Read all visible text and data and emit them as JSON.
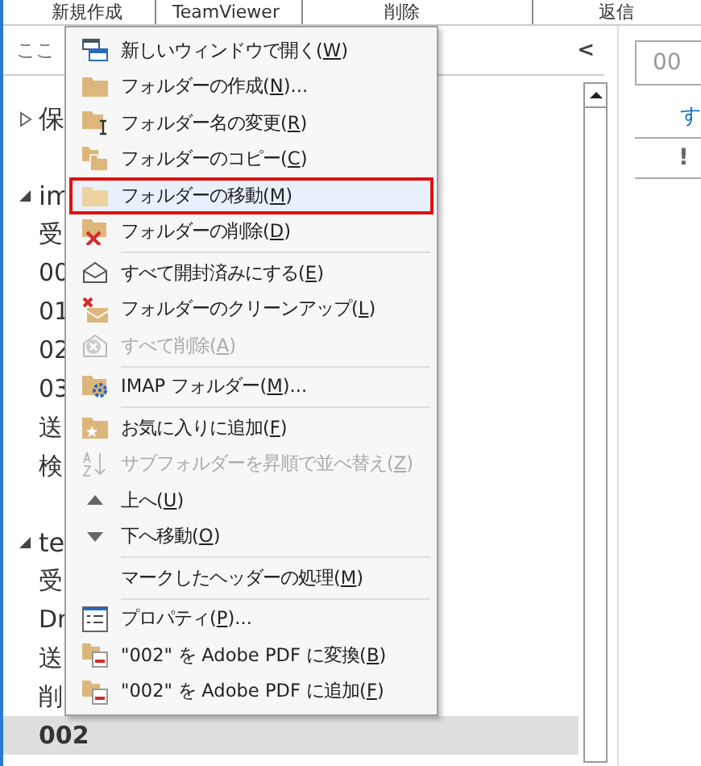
{
  "toolbar": {
    "buttons": [
      "新規作成",
      "TeamViewer",
      "削除",
      "返信"
    ]
  },
  "folder_pane": {
    "search": {
      "placeholder": "ここ"
    },
    "collapse": "<",
    "tree": [
      {
        "label": "保",
        "expanded": false,
        "selected": false
      },
      {
        "label": "im",
        "expanded": true,
        "selected": false,
        "children": [
          {
            "label": "受",
            "selected": false
          },
          {
            "label": "00",
            "selected": false
          },
          {
            "label": "01",
            "selected": false
          },
          {
            "label": "02",
            "selected": false
          },
          {
            "label": "03",
            "selected": false
          },
          {
            "label": "送",
            "selected": false
          },
          {
            "label": "検",
            "selected": false
          }
        ]
      },
      {
        "label": "te",
        "expanded": true,
        "selected": false,
        "children": [
          {
            "label": "受",
            "selected": false
          },
          {
            "label": "Dr",
            "selected": false
          },
          {
            "label": "送",
            "selected": false
          },
          {
            "label": "削",
            "selected": false
          },
          {
            "label": "002",
            "selected": true
          }
        ]
      }
    ]
  },
  "reading_pane": {
    "field": "00",
    "link": "す",
    "flag_column": "!"
  },
  "context_menu": {
    "items": [
      {
        "kind": "item",
        "label": "新しいウィンドウで開く(W)",
        "disabled": false,
        "selected": false
      },
      {
        "kind": "item",
        "label": "フォルダーの作成(N)...",
        "disabled": false,
        "selected": false
      },
      {
        "kind": "item",
        "label": "フォルダー名の変更(R)",
        "disabled": false,
        "selected": false
      },
      {
        "kind": "item",
        "label": "フォルダーのコピー(C)",
        "disabled": false,
        "selected": false
      },
      {
        "kind": "item",
        "label": "フォルダーの移動(M)",
        "disabled": false,
        "selected": true
      },
      {
        "kind": "item",
        "label": "フォルダーの削除(D)",
        "disabled": false,
        "selected": false
      },
      {
        "kind": "separator"
      },
      {
        "kind": "item",
        "label": "すべて開封済みにする(E)",
        "disabled": false,
        "selected": false
      },
      {
        "kind": "item",
        "label": "フォルダーのクリーンアップ(L)",
        "disabled": false,
        "selected": false
      },
      {
        "kind": "item",
        "label": "すべて削除(A)",
        "disabled": true,
        "selected": false
      },
      {
        "kind": "separator"
      },
      {
        "kind": "item",
        "label": "IMAP フォルダー(M)...",
        "disabled": false,
        "selected": false
      },
      {
        "kind": "separator"
      },
      {
        "kind": "item",
        "label": "お気に入りに追加(F)",
        "disabled": false,
        "selected": false
      },
      {
        "kind": "item",
        "label": "サブフォルダーを昇順で並べ替え(Z)",
        "disabled": true,
        "selected": false
      },
      {
        "kind": "item",
        "label": "上へ(U)",
        "disabled": false,
        "selected": false
      },
      {
        "kind": "item",
        "label": "下へ移動(O)",
        "disabled": false,
        "selected": false
      },
      {
        "kind": "separator"
      },
      {
        "kind": "item",
        "label": "マークしたヘッダーの処理(M)",
        "disabled": false,
        "selected": false
      },
      {
        "kind": "separator"
      },
      {
        "kind": "item",
        "label": "プロパティ(P)...",
        "disabled": false,
        "selected": false
      },
      {
        "kind": "item",
        "label": "\"002\" を Adobe PDF に変換(B)",
        "disabled": false,
        "selected": false
      },
      {
        "kind": "item",
        "label": "\"002\" を Adobe PDF に追加(F)",
        "disabled": false,
        "selected": false
      }
    ]
  }
}
